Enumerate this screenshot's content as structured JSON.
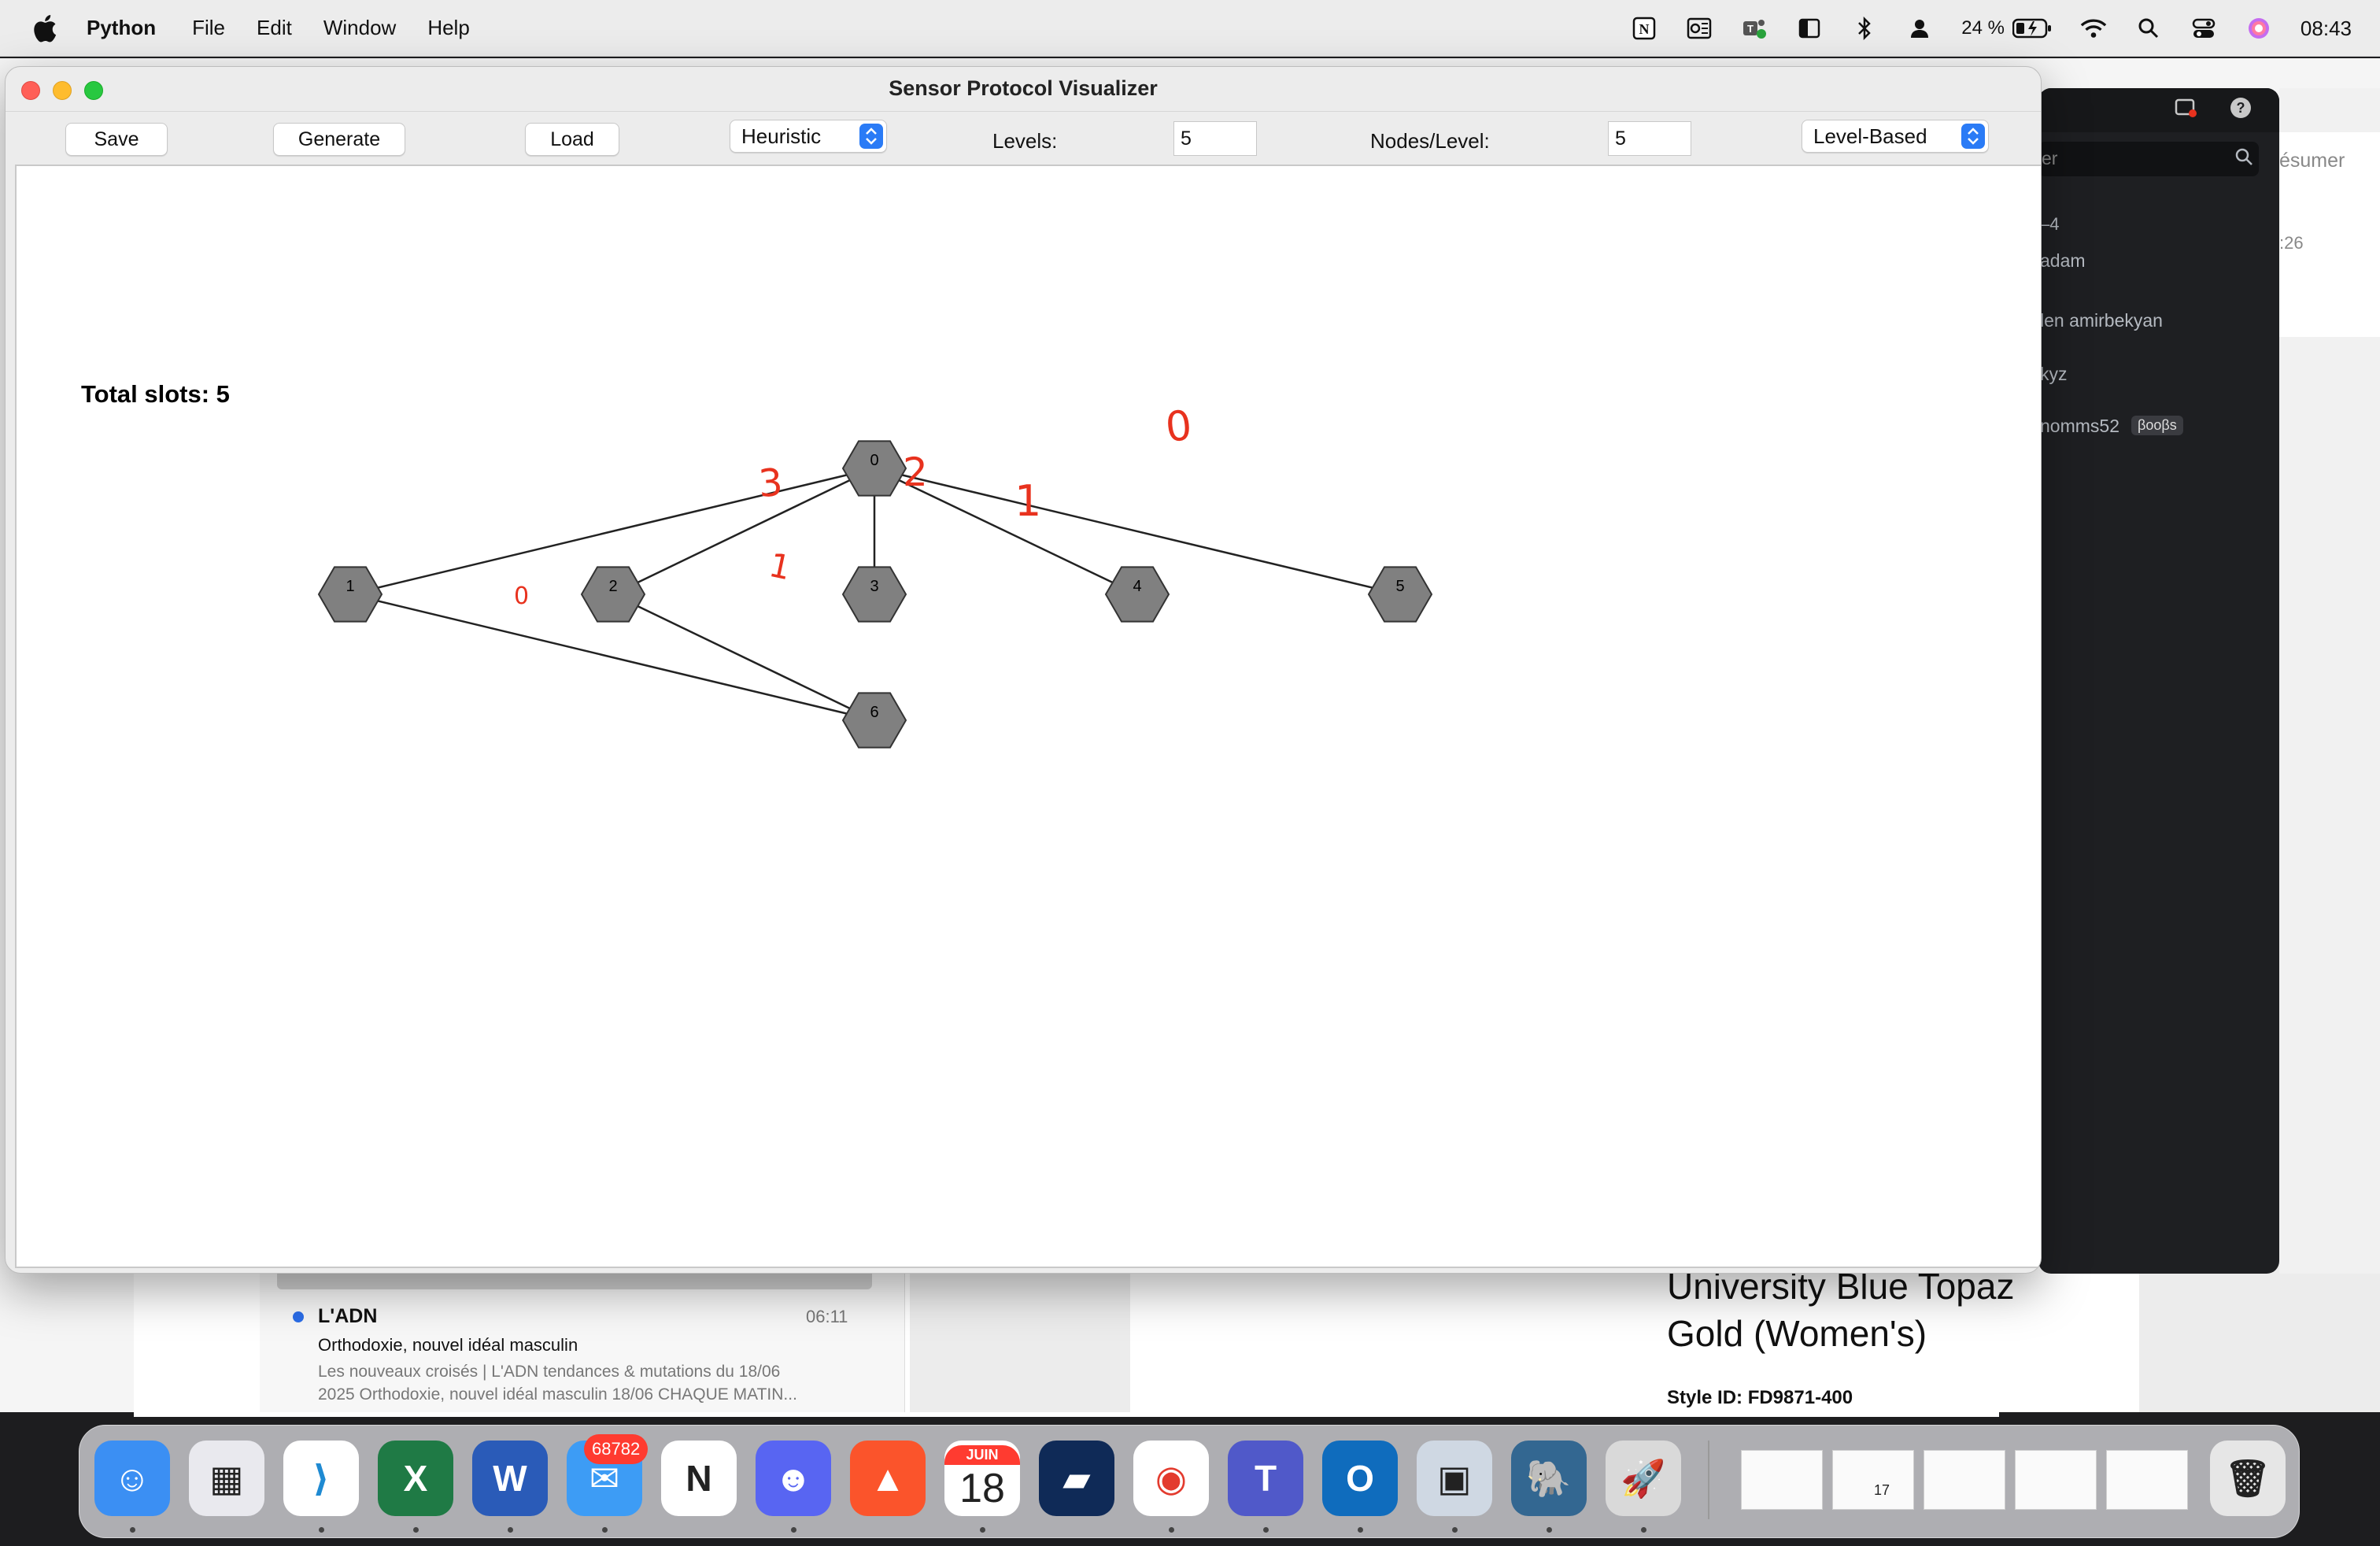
{
  "menubar": {
    "app_name": "Python",
    "menus": [
      "File",
      "Edit",
      "Window",
      "Help"
    ],
    "battery_percent": "24 %",
    "clock": "08:43"
  },
  "window": {
    "title": "Sensor Protocol Visualizer"
  },
  "toolbar": {
    "save_label": "Save",
    "generate_label": "Generate",
    "load_label": "Load",
    "algorithm_select": "Heuristic",
    "levels_label": "Levels:",
    "levels_value": "5",
    "nodes_per_level_label": "Nodes/Level:",
    "nodes_per_level_value": "5",
    "layout_select": "Level-Based"
  },
  "canvas": {
    "total_slots_text": "Total slots: 5",
    "node_fill": "#808080",
    "node_stroke": "#333333",
    "edge_color": "#222222",
    "annotation_color": "#e8321e",
    "nodes": [
      "0",
      "1",
      "2",
      "3",
      "4",
      "5",
      "6"
    ],
    "edges": [
      [
        "0",
        "1"
      ],
      [
        "0",
        "2"
      ],
      [
        "0",
        "3"
      ],
      [
        "0",
        "4"
      ],
      [
        "0",
        "5"
      ],
      [
        "1",
        "6"
      ],
      [
        "2",
        "6"
      ]
    ],
    "handwritten_annotations": [
      "3",
      "2",
      "1",
      "0",
      "1",
      "0"
    ]
  },
  "background": {
    "mail": {
      "sender": "L'ADN",
      "time": "06:11",
      "subject": "Orthodoxie, nouvel idéal masculin",
      "preview_line1": "Les nouveaux croisés | L'ADN tendances & mutations du 18/06",
      "preview_line2": "2025 Orthodoxie, nouvel idéal masculin 18/06 CHAQUE MATIN..."
    },
    "product": {
      "title_line1": "University Blue Topaz",
      "title_line2": "Gold (Women's)",
      "style_id": "Style ID: FD9871-400"
    },
    "chat": {
      "search_fragment": "er",
      "item1": "–4",
      "item2": "adam",
      "item3": "len amirbekyan",
      "item4": "kyz",
      "item5": "nomms52",
      "badge": "βooβs"
    },
    "right_strip": {
      "label": "ésumer",
      "time_fragment": ":26"
    }
  },
  "dock": {
    "mail_badge": "68782",
    "calendar_month": "JUIN",
    "calendar_day": "18",
    "thumb_calendar_day": "17",
    "apps": [
      "finder-icon",
      "launchpad-icon",
      "vscode-icon",
      "excel-icon",
      "word-icon",
      "mail-icon",
      "notion-icon",
      "discord-icon",
      "brave-icon",
      "calendar-icon",
      "linear-icon",
      "chrome-icon",
      "teams-icon",
      "outlook-icon",
      "preview-icon",
      "postgres-icon",
      "python-launcher-icon",
      "trash-icon"
    ]
  }
}
